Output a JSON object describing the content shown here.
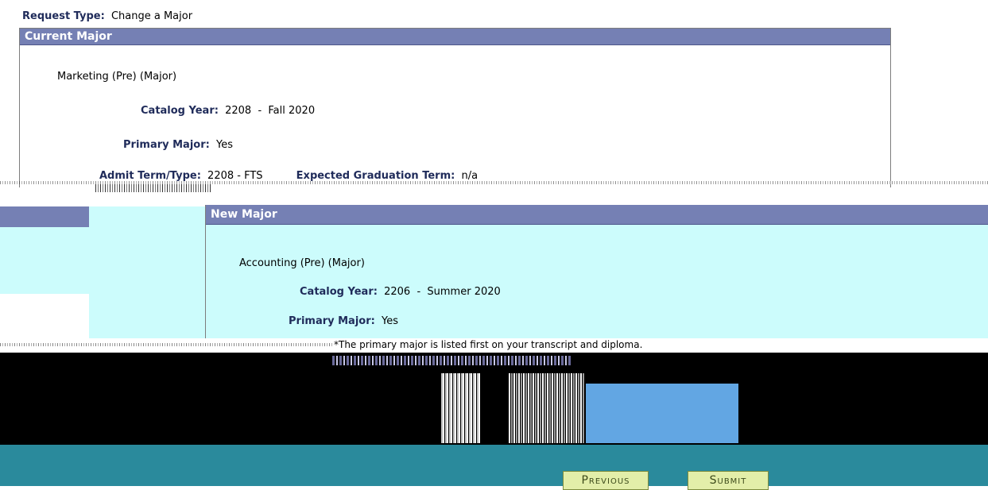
{
  "request": {
    "type_label": "Request Type:",
    "type_value": "Change a Major"
  },
  "current_major": {
    "header": "Current Major",
    "program": "Marketing (Pre) (Major)",
    "catalog_year_label": "Catalog Year:",
    "catalog_year_value": "2208  -  Fall 2020",
    "primary_major_label": "Primary Major:",
    "primary_major_value": "Yes",
    "admit_term_label": "Admit Term/Type:",
    "admit_term_value": "2208 - FTS",
    "expected_grad_label": "Expected Graduation Term:",
    "expected_grad_value": "n/a"
  },
  "new_major": {
    "header": "New Major",
    "program": "Accounting (Pre) (Major)",
    "catalog_year_label": "Catalog Year:",
    "catalog_year_value": "2206  -  Summer 2020",
    "primary_major_label": "Primary Major:",
    "primary_major_value": "Yes"
  },
  "notice": {
    "text": "*The primary major is listed first on your transcript and diploma."
  },
  "buttons": {
    "previous": "Previous",
    "submit": "Submit"
  },
  "colors": {
    "header_bar": "#7580b4",
    "cyan_panel": "#ccfcfc",
    "footer": "#2a8a9c",
    "button": "#e3eea9"
  }
}
